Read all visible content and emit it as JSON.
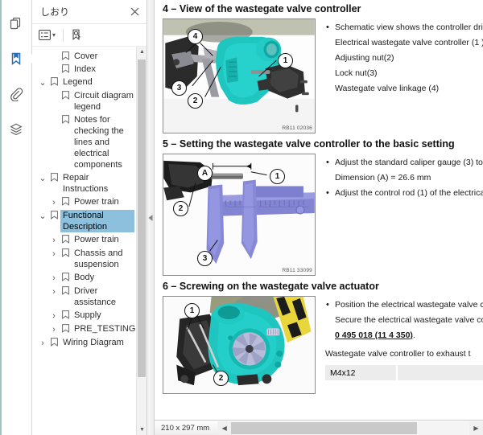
{
  "window": {
    "page_size": "210 x 297 mm"
  },
  "rail": {
    "items": [
      {
        "name": "pages-icon",
        "label": "Page Thumbnails",
        "active": false
      },
      {
        "name": "bookmark-icon",
        "label": "Bookmarks",
        "active": true
      },
      {
        "name": "attachment-icon",
        "label": "Attachments",
        "active": false
      },
      {
        "name": "layers-icon",
        "label": "Layers",
        "active": false
      }
    ]
  },
  "panel": {
    "title": "しおり",
    "close_label": "✕",
    "toolbar": {
      "options_label": "Options",
      "expand_caret": "▾",
      "find_bookmark_label": "Highlight current bookmark"
    }
  },
  "tree": [
    {
      "label": "Cover",
      "level": 1,
      "twisty": "",
      "selected": false
    },
    {
      "label": "Index",
      "level": 1,
      "twisty": "",
      "selected": false
    },
    {
      "label": "Legend",
      "level": 0,
      "twisty": "⌄",
      "selected": false
    },
    {
      "label": "Circuit diagram legend",
      "level": 1,
      "twisty": "",
      "selected": false
    },
    {
      "label": "Notes for checking the lines and electrical components",
      "level": 1,
      "twisty": "",
      "selected": false
    },
    {
      "label": "Repair Instructions",
      "level": 0,
      "twisty": "⌄",
      "selected": false
    },
    {
      "label": "Power train",
      "level": 1,
      "twisty": "›",
      "selected": false
    },
    {
      "label": "Functional Description",
      "level": 0,
      "twisty": "⌄",
      "selected": true
    },
    {
      "label": "Power train",
      "level": 1,
      "twisty": "›",
      "selected": false
    },
    {
      "label": "Chassis and suspension",
      "level": 1,
      "twisty": "›",
      "selected": false
    },
    {
      "label": "Body",
      "level": 1,
      "twisty": "›",
      "selected": false
    },
    {
      "label": "Driver assistance",
      "level": 1,
      "twisty": "›",
      "selected": false
    },
    {
      "label": "Supply",
      "level": 1,
      "twisty": "›",
      "selected": false
    },
    {
      "label": "PRE_TESTING",
      "level": 1,
      "twisty": "›",
      "selected": false
    },
    {
      "label": "Wiring Diagram",
      "level": 0,
      "twisty": "›",
      "selected": false
    }
  ],
  "document": {
    "sections": [
      {
        "title": "4 – View of the wastegate valve controller",
        "figure_caption": "RB11 02036",
        "callouts": [
          "1",
          "2",
          "3",
          "4"
        ],
        "bullets": [
          {
            "text": "Schematic view shows the controller driv",
            "dot": true
          },
          {
            "text": "Electrical wastegate valve controller (1 )",
            "dot": false
          },
          {
            "text": "Adjusting nut(2)",
            "dot": false
          },
          {
            "text": "Lock nut(3)",
            "dot": false
          },
          {
            "text": "Wastegate valve linkage (4)",
            "dot": false
          }
        ]
      },
      {
        "title": "5 – Setting the wastegate valve controller to the basic setting",
        "figure_caption": "RB11 33099",
        "callouts": [
          "1",
          "2",
          "3",
          "A"
        ],
        "bullets": [
          {
            "text": "Adjust the standard caliper gauge (3) to",
            "dot": true
          },
          {
            "text": "Dimension (A) = 26.6 mm",
            "dot": false
          },
          {
            "text": "Adjust the control rod (1) of the electrica",
            "dot": true
          }
        ]
      },
      {
        "title": "6 – Screwing on the wastegate valve actuator",
        "figure_caption": "",
        "callouts": [
          "1",
          "2"
        ],
        "bullets": [
          {
            "text": "Position the electrical wastegate valve co",
            "dot": true
          },
          {
            "text": "Secure the electrical wastegate valve co",
            "dot": false
          }
        ],
        "link_text": "0 495 018 (11 4 350)",
        "link_suffix": ".",
        "heading": "Wastegate valve controller to exhaust t",
        "table_row": {
          "col1": "M4x12",
          "col2": ""
        }
      }
    ]
  },
  "colors": {
    "accent": "#2a6db5",
    "selection": "#8cc0dc",
    "turbo_teal": "#1fc6c0",
    "caliper_purple": "#7e7fcf",
    "warn_yellow": "#e8d63c"
  }
}
